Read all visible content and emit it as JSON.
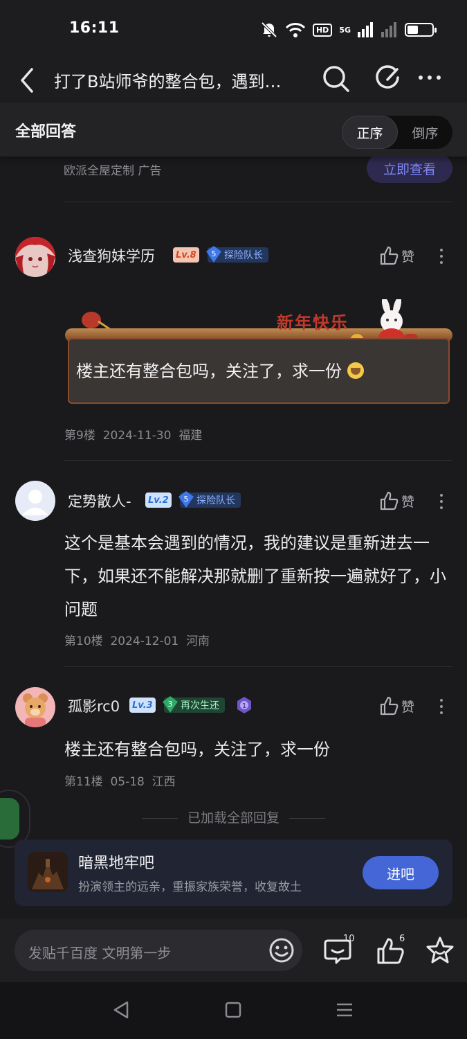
{
  "status_bar": {
    "time": "16:11",
    "hd": "HD",
    "network": "5G",
    "battery_level": 0.45
  },
  "header": {
    "title": "打了B站师爷的整合包，遇到…"
  },
  "section": {
    "label": "全部回答",
    "sort_options": [
      "正序",
      "倒序"
    ],
    "selected_sort": "正序"
  },
  "ad": {
    "source": "欧派全屋定制  广告",
    "button": "立即查看"
  },
  "posts": [
    {
      "username": "浅查狗妹学历",
      "level": "Lv.8",
      "badge_number": "5",
      "badge_label": "探险队长",
      "like_label": "赞",
      "banner_text": "新年快乐",
      "content": "楼主还有整合包吗，关注了，求一份",
      "floor": "第9楼",
      "date": "2024-11-30",
      "location": "福建"
    },
    {
      "username": "定势散人-",
      "level": "Lv.2",
      "badge_number": "5",
      "badge_label": "探险队长",
      "like_label": "赞",
      "content": "这个是基本会遇到的情况，我的建议是重新进去一下，如果还不能解决那就删了重新按一遍就好了，小问题",
      "floor": "第10楼",
      "date": "2024-12-01",
      "location": "河南"
    },
    {
      "username": "孤影rc0",
      "level": "Lv.3",
      "badge_number": "3",
      "badge_label": "再次生还",
      "extra_badge": "1",
      "like_label": "赞",
      "content": "楼主还有整合包吗，关注了，求一份",
      "floor": "第11楼",
      "date": "05-18",
      "location": "江西"
    }
  ],
  "loaded_text": "已加载全部回复",
  "forum": {
    "name": "暗黑地牢吧",
    "description": "扮演领主的远亲，重振家族荣誉，收复故土",
    "join_label": "进吧"
  },
  "bottom_bar": {
    "placeholder": "发贴千百度 文明第一步",
    "comment_count": "10",
    "like_count": "6"
  }
}
